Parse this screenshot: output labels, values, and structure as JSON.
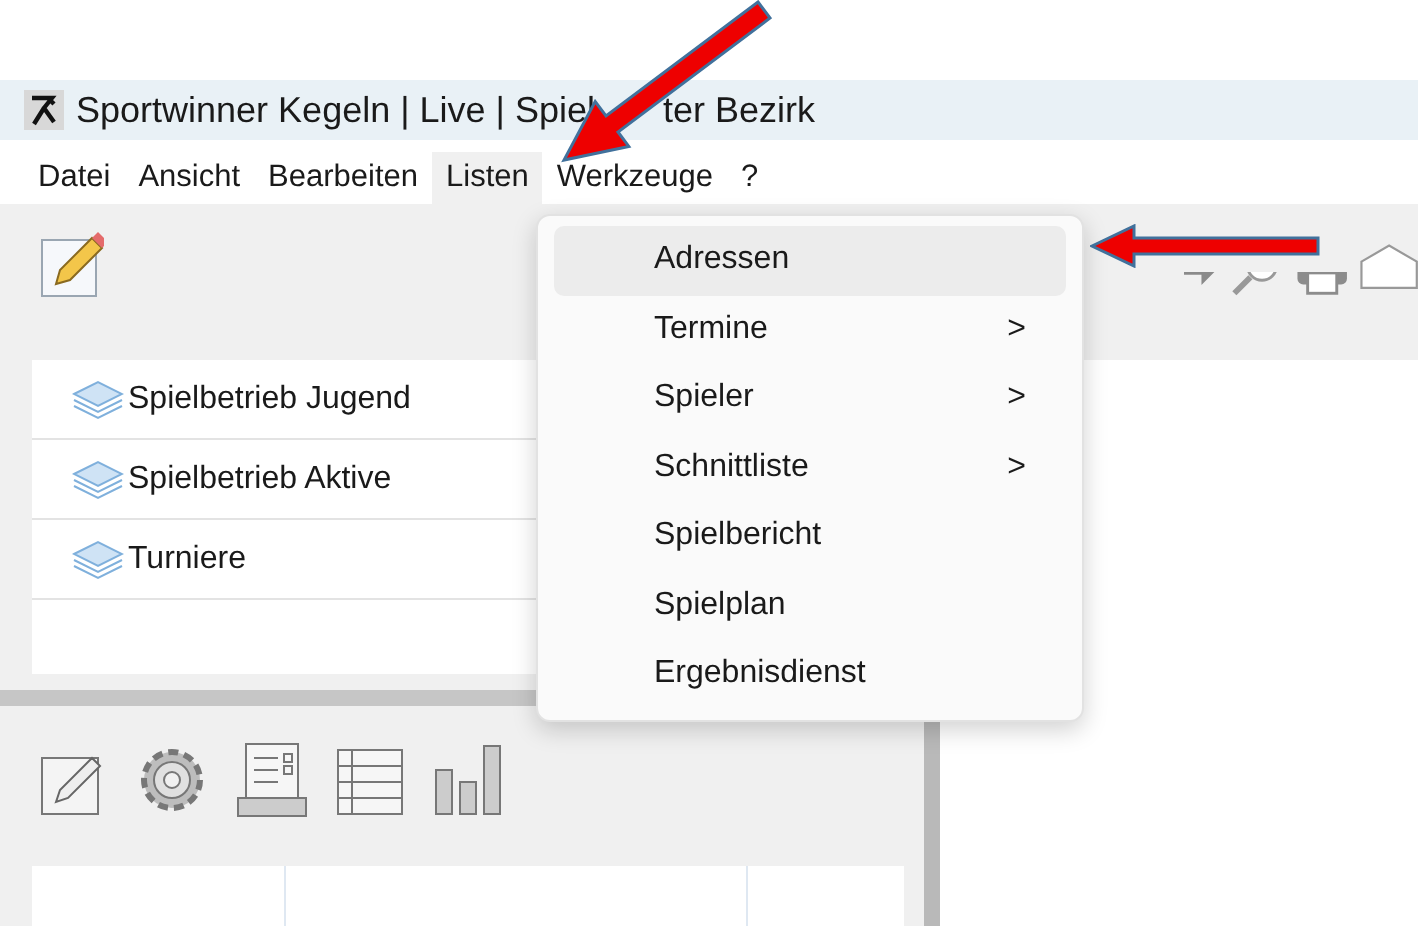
{
  "window": {
    "title_parts": [
      "Sportwinner Kegeln | Live | Spiel",
      "ter Bezirk"
    ]
  },
  "menu_bar": [
    {
      "label": "Datei",
      "selected": false
    },
    {
      "label": "Ansicht",
      "selected": false
    },
    {
      "label": "Bearbeiten",
      "selected": false
    },
    {
      "label": "Listen",
      "selected": true
    },
    {
      "label": "Werkzeuge",
      "selected": false
    },
    {
      "label": "?",
      "selected": false
    }
  ],
  "dropdown": {
    "items": [
      {
        "label": "Adressen",
        "selected": true,
        "submenu": false
      },
      {
        "label": "Termine",
        "selected": false,
        "submenu": true
      },
      {
        "label": "Spieler",
        "selected": false,
        "submenu": true
      },
      {
        "label": "Schnittliste",
        "selected": false,
        "submenu": true
      },
      {
        "label": "Spielbericht",
        "selected": false,
        "submenu": false
      },
      {
        "label": "Spielplan",
        "selected": false,
        "submenu": false
      },
      {
        "label": "Ergebnisdienst",
        "selected": false,
        "submenu": false
      }
    ],
    "chevron": ">"
  },
  "tree": {
    "items": [
      {
        "label": "Spielbetrieb Jugend"
      },
      {
        "label": "Spielbetrieb Aktive"
      },
      {
        "label": "Turniere"
      }
    ]
  }
}
